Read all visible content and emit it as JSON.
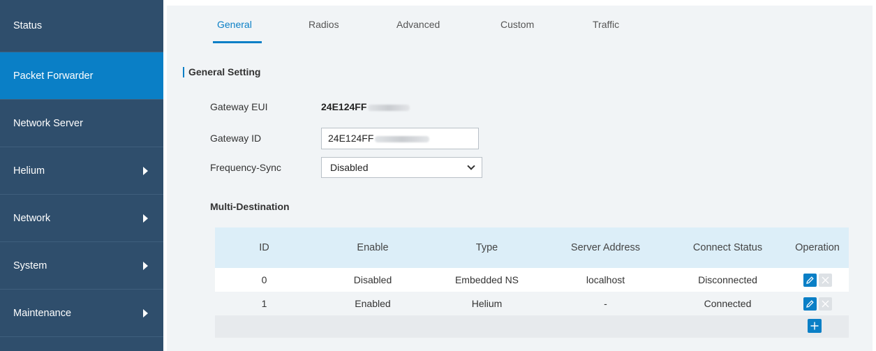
{
  "sidebar": {
    "items": [
      {
        "label": "Status"
      },
      {
        "label": "Packet Forwarder"
      },
      {
        "label": "Network Server"
      },
      {
        "label": "Helium"
      },
      {
        "label": "Network"
      },
      {
        "label": "System"
      },
      {
        "label": "Maintenance"
      }
    ]
  },
  "tabs": [
    {
      "label": "General"
    },
    {
      "label": "Radios"
    },
    {
      "label": "Advanced"
    },
    {
      "label": "Custom"
    },
    {
      "label": "Traffic"
    }
  ],
  "general": {
    "section_title": "General Setting",
    "gateway_eui_label": "Gateway EUI",
    "gateway_eui_value": "24E124FF",
    "gateway_id_label": "Gateway ID",
    "gateway_id_value": "24E124FF",
    "frequency_sync_label": "Frequency-Sync",
    "frequency_sync_value": "Disabled",
    "multi_destination_label": "Multi-Destination"
  },
  "table": {
    "headers": {
      "id": "ID",
      "enable": "Enable",
      "type": "Type",
      "server": "Server Address",
      "status": "Connect Status",
      "operation": "Operation"
    },
    "rows": [
      {
        "id": "0",
        "enable": "Disabled",
        "type": "Embedded NS",
        "server": "localhost",
        "status": "Disconnected"
      },
      {
        "id": "1",
        "enable": "Enabled",
        "type": "Helium",
        "server": "-",
        "status": "Connected"
      }
    ]
  },
  "colors": {
    "accent": "#0a7fc6",
    "sidebar": "#2f4e6c",
    "table_header": "#dceef8"
  }
}
